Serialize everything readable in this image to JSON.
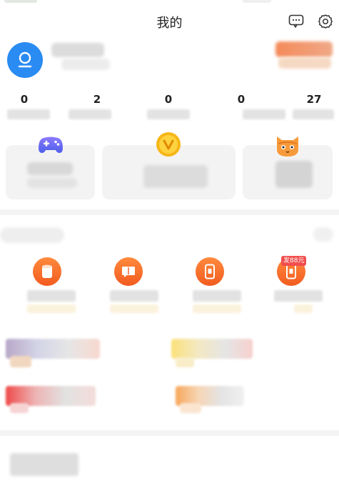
{
  "header": {
    "title": "我的",
    "icons": {
      "message": "message-icon",
      "settings": "gear-icon"
    }
  },
  "profile": {
    "avatar_icon": "user-icon",
    "accent": "#2a8bf2"
  },
  "stats": [
    {
      "value": "0"
    },
    {
      "value": "2"
    },
    {
      "value": "0"
    },
    {
      "value": "0"
    },
    {
      "value": "27"
    }
  ],
  "cards": [
    {
      "icon": "gamepad-icon"
    },
    {
      "icon": "gold-coin-icon"
    },
    {
      "icon": "cat-icon"
    }
  ],
  "tools": [
    {
      "icon": "box-icon",
      "badge": ""
    },
    {
      "icon": "chat-card-icon",
      "badge": ""
    },
    {
      "icon": "phone-icon",
      "badge": ""
    },
    {
      "icon": "phone-gift-icon",
      "badge": "发88元"
    }
  ],
  "colors": {
    "orange": "#f25b1f",
    "badge": "#f14d4d",
    "divider": "#f4f4f4"
  }
}
